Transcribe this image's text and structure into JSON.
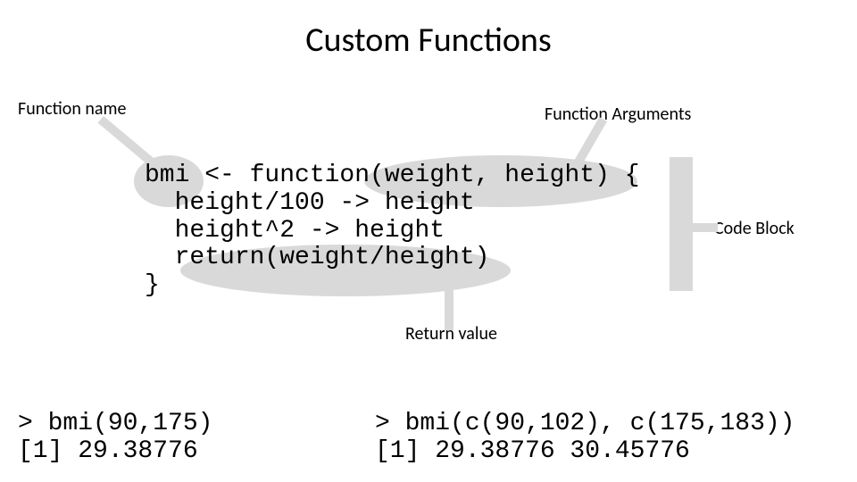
{
  "title": "Custom Functions",
  "labels": {
    "function_name": "Function name",
    "function_arguments": "Function Arguments",
    "code_block": "Code Block",
    "return_value": "Return value"
  },
  "code": {
    "main": "bmi <- function(weight, height) {\n  height/100 -> height\n  height^2 -> height\n  return(weight/height)\n}",
    "example1": "> bmi(90,175)\n[1] 29.38776",
    "example2": "> bmi(c(90,102), c(175,183))\n[1] 29.38776 30.45776"
  },
  "annotations": {
    "function_name_token": "bmi",
    "arguments_token": "(weight, height)",
    "return_token": "return(weight/height)"
  }
}
